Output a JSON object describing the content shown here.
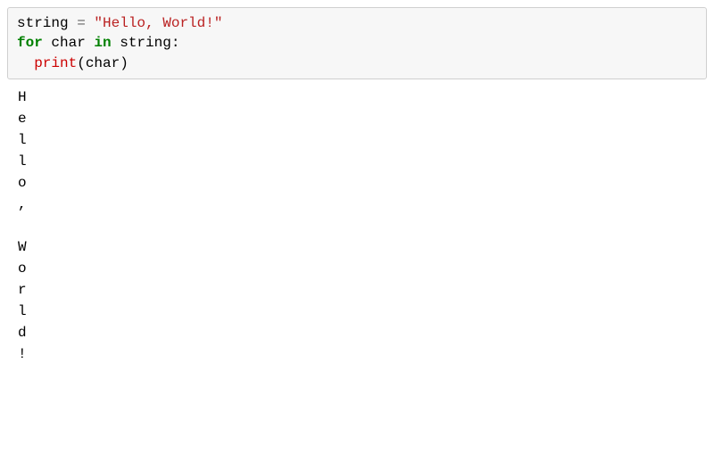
{
  "code": {
    "line1": {
      "var": "string",
      "assign": " = ",
      "literal": "\"Hello, World!\""
    },
    "line2": {
      "for_kw": "for",
      "loop_var": " char ",
      "in_kw": "in",
      "iterable": " string",
      "colon": ":"
    },
    "line3": {
      "indent": "  ",
      "func": "print",
      "call": "(char)"
    }
  },
  "output": {
    "lines": [
      "H",
      "e",
      "l",
      "l",
      "o",
      ",",
      "",
      "W",
      "o",
      "r",
      "l",
      "d",
      "!"
    ]
  }
}
